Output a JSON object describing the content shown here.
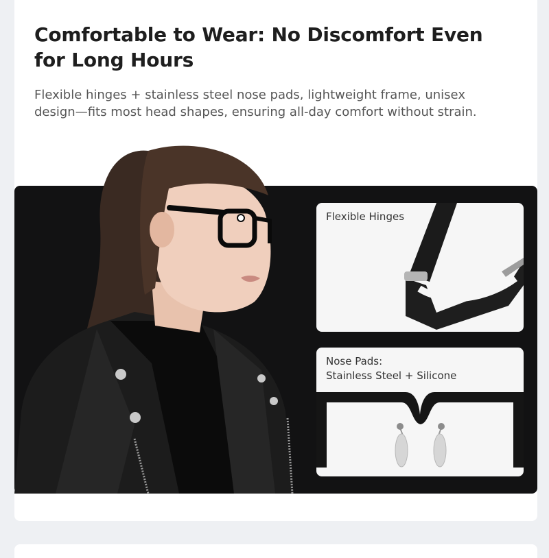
{
  "headline": "Comfortable to Wear: No Discomfort Even for Long Hours",
  "description": "Flexible hinges + stainless steel nose pads, lightweight frame, unisex design—fits most head shapes, ensuring all-day comfort without strain.",
  "details": {
    "hinges_label": "Flexible Hinges",
    "nose_pads_label_line1": "Nose Pads:",
    "nose_pads_label_line2": "Stainless Steel + Silicone"
  }
}
